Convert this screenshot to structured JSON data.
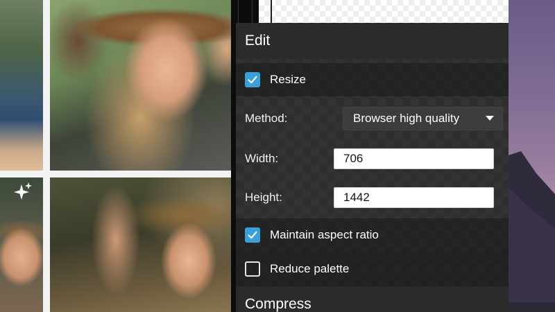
{
  "panel": {
    "edit_section_title": "Edit",
    "compress_section_title": "Compress",
    "resize": {
      "label": "Resize",
      "checked": true
    },
    "method": {
      "label": "Method:",
      "selected": "Browser high quality"
    },
    "width": {
      "label": "Width:",
      "value": "706"
    },
    "height": {
      "label": "Height:",
      "value": "1442"
    },
    "maintain_aspect": {
      "label": "Maintain aspect ratio",
      "checked": true
    },
    "reduce_palette": {
      "label": "Reduce palette",
      "checked": false
    }
  },
  "colors": {
    "checkbox_accent": "#3aa0d8",
    "panel_background": "#333333",
    "section_header_background": "#2b2b2b"
  },
  "icons": [
    "sparkle-icon",
    "checkmark-icon",
    "chevron-down-icon"
  ]
}
